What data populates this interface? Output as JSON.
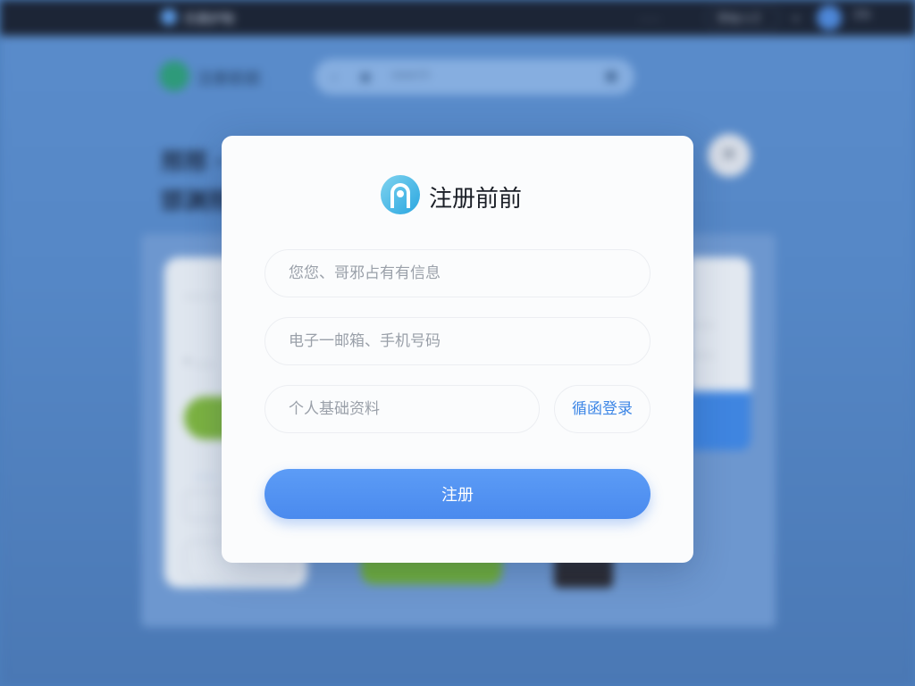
{
  "background": {
    "topbar": {
      "site_name": "乐鼎护物",
      "nav_item": "……",
      "pill_label": "Ship s 2",
      "lang_label": "EN"
    },
    "header": {
      "title": "注册前前",
      "search_placeholder": "search"
    },
    "hero": {
      "line1": "邢邢 ·",
      "line2": "邯渊邢 ·"
    },
    "cards": {
      "a_text1": "…… …",
      "a_text2": "• ……",
      "a_link": "……",
      "b_text1": "……",
      "b_text2": "……"
    }
  },
  "modal": {
    "title": "注册前前",
    "fields": {
      "name_placeholder": "您您、哥邪占有有信息",
      "contact_placeholder": "电子一邮箱、手机号码",
      "profile_placeholder": "个人基础资料"
    },
    "side_link_label": "循函登录",
    "submit_label": "注册"
  },
  "colors": {
    "accent": "#4a8aee",
    "link": "#3d86e6",
    "backdrop": "#4d7fbd"
  },
  "icons": {
    "brand": "brand-logo-icon",
    "close": "close-icon",
    "search": "search-icon"
  }
}
